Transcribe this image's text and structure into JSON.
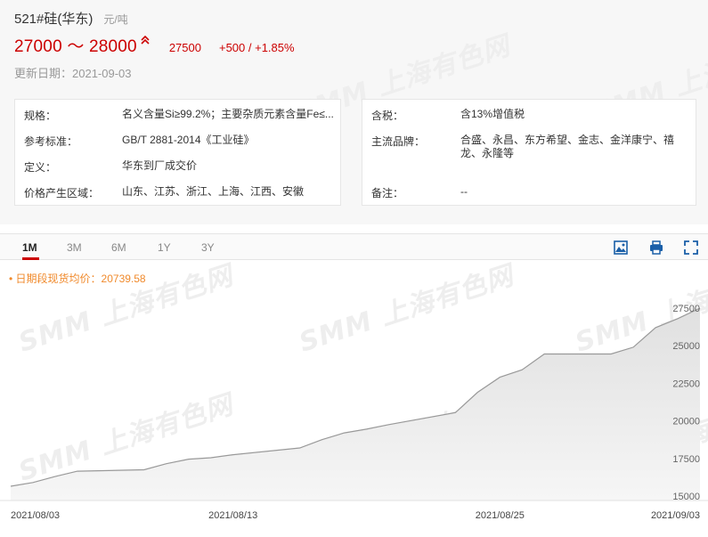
{
  "header": {
    "title": "521#硅(华东)",
    "unit": "元/吨",
    "price_range": "27000 ～ 28000",
    "avg_price": "27500",
    "change": "+500 / +1.85%",
    "update_label": "更新日期：",
    "update_date": "2021-09-03"
  },
  "info_left": [
    {
      "key": "规格：",
      "value": "名义含量Si≥99.2%；主要杂质元素含量Fe≤..."
    },
    {
      "key": "参考标准：",
      "value": "GB/T 2881-2014《工业硅》"
    },
    {
      "key": "定义：",
      "value": "华东到厂成交价"
    },
    {
      "key": "价格产生区域：",
      "value": "山东、江苏、浙江、上海、江西、安徽"
    }
  ],
  "info_right": [
    {
      "key": "含税：",
      "value": "含13%增值税"
    },
    {
      "key": "主流品牌：",
      "value": "合盛、永昌、东方希望、金志、金洋康宁、禧龙、永隆等"
    },
    {
      "key": "备注：",
      "value": "--"
    }
  ],
  "tabs": [
    "1M",
    "3M",
    "6M",
    "1Y",
    "3Y"
  ],
  "active_tab": "1M",
  "toolbar_icons": [
    "image-download-icon",
    "print-icon",
    "fullscreen-icon"
  ],
  "watermark": "SMM 上海有色网",
  "period_avg_label": "日期段现货均价：20739.58",
  "colors": {
    "price_red": "#cc0000",
    "avg_orange": "#f08a2c",
    "line": "#999999",
    "area": "#e0e0e0"
  },
  "chart_data": {
    "type": "area",
    "x": [
      "2021-08-03",
      "2021-08-04",
      "2021-08-05",
      "2021-08-06",
      "2021-08-09",
      "2021-08-10",
      "2021-08-11",
      "2021-08-12",
      "2021-08-13",
      "2021-08-16",
      "2021-08-17",
      "2021-08-18",
      "2021-08-19",
      "2021-08-20",
      "2021-08-23",
      "2021-08-24",
      "2021-08-25",
      "2021-08-26",
      "2021-08-27",
      "2021-08-30",
      "2021-08-31",
      "2021-09-01",
      "2021-09-02",
      "2021-09-03"
    ],
    "series": [
      {
        "values": [
          15650,
          15900,
          16300,
          16650,
          16750,
          17150,
          17450,
          17550,
          17750,
          18200,
          18750,
          19200,
          19450,
          19750,
          20550,
          21900,
          22900,
          23400,
          24450,
          24450,
          24900,
          26200,
          26800,
          27500
        ]
      }
    ],
    "x_tick_labels": [
      "2021/08/03",
      "2021/08/13",
      "2021/08/25",
      "2021/09/03"
    ],
    "y_tick_labels": [
      "15000",
      "17500",
      "20000",
      "22500",
      "25000",
      "27500"
    ],
    "ylim": [
      15000,
      27500
    ],
    "grid": false,
    "y_axis_side": "right"
  }
}
